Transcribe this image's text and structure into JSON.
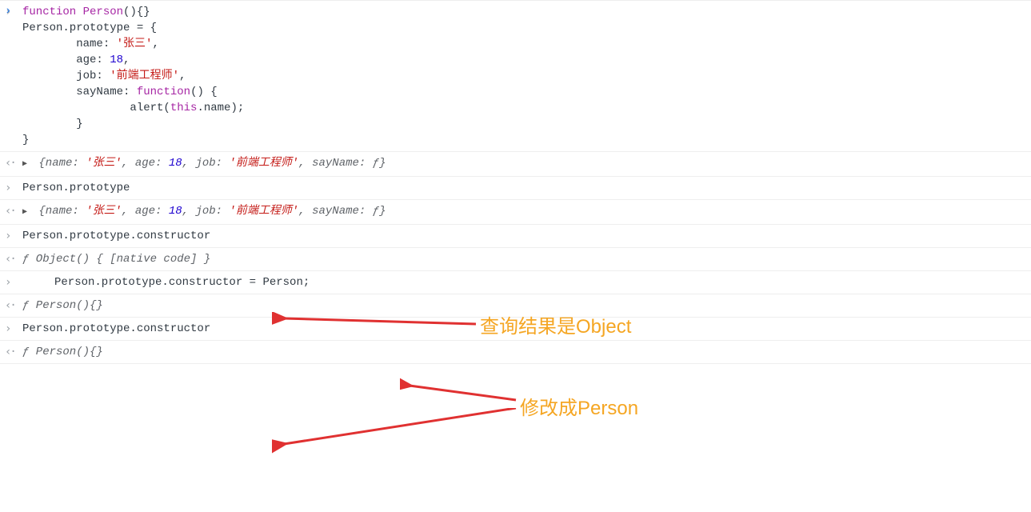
{
  "rows": [
    {
      "type": "input",
      "code": [
        {
          "segments": [
            {
              "t": "function",
              "cls": "kw"
            },
            {
              "t": " "
            },
            {
              "t": "Person",
              "cls": "fn"
            },
            {
              "t": "(){} "
            }
          ]
        },
        {
          "segments": [
            {
              "t": "Person.prototype = {"
            }
          ]
        },
        {
          "indent": 2,
          "segments": [
            {
              "t": "name: "
            },
            {
              "t": "'张三'",
              "cls": "str"
            },
            {
              "t": ","
            }
          ]
        },
        {
          "indent": 2,
          "segments": [
            {
              "t": "age: "
            },
            {
              "t": "18",
              "cls": "num"
            },
            {
              "t": ","
            }
          ]
        },
        {
          "indent": 2,
          "segments": [
            {
              "t": "job: "
            },
            {
              "t": "'前端工程师'",
              "cls": "str"
            },
            {
              "t": ","
            }
          ]
        },
        {
          "indent": 2,
          "segments": [
            {
              "t": "sayName: "
            },
            {
              "t": "function",
              "cls": "kw"
            },
            {
              "t": "() {"
            }
          ]
        },
        {
          "indent": 4,
          "segments": [
            {
              "t": "alert("
            },
            {
              "t": "this",
              "cls": "kw"
            },
            {
              "t": ".name);"
            }
          ]
        },
        {
          "indent": 2,
          "segments": [
            {
              "t": "}"
            }
          ]
        },
        {
          "segments": [
            {
              "t": "}"
            }
          ]
        }
      ]
    },
    {
      "type": "output",
      "expandable": true,
      "obj": "{name: '张三', age: 18, job: '前端工程师', sayName: ƒ}"
    },
    {
      "type": "input",
      "simple": "Person.prototype"
    },
    {
      "type": "output",
      "expandable": true,
      "obj": "{name: '张三', age: 18, job: '前端工程师', sayName: ƒ}"
    },
    {
      "type": "input",
      "simple": "Person.prototype.constructor"
    },
    {
      "type": "output",
      "italic": "ƒ Object() { [native code] }"
    },
    {
      "type": "input",
      "indented": true,
      "simple": "Person.prototype.constructor = Person;"
    },
    {
      "type": "output",
      "italic": "ƒ Person(){}"
    },
    {
      "type": "input",
      "simple": "Person.prototype.constructor"
    },
    {
      "type": "output",
      "italic": "ƒ Person(){}"
    }
  ],
  "annotations": {
    "a1": "查询结果是Object",
    "a2": "修改成Person"
  },
  "prompt": ""
}
